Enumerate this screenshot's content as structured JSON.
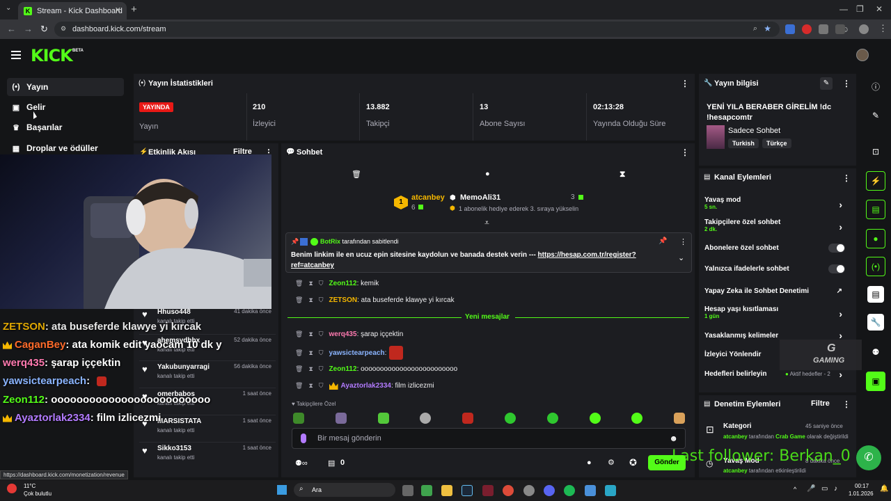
{
  "browser": {
    "tab_title": "Stream - Kick Dashboard",
    "url": "dashboard.kick.com/stream",
    "status_url": "https://dashboard.kick.com/monetization/revenue"
  },
  "header": {
    "logo": "KICK",
    "beta": "BETA"
  },
  "sidebar": {
    "items": [
      {
        "label": "Yayın",
        "icon": "broadcast-icon"
      },
      {
        "label": "Gelir",
        "icon": "revenue-icon"
      },
      {
        "label": "Başarılar",
        "icon": "trophy-icon"
      },
      {
        "label": "Droplar ve ödüller",
        "icon": "gift-icon"
      }
    ]
  },
  "stats": {
    "title": "Yayın İstatistikleri",
    "live_badge": "YAYINDA",
    "items": [
      {
        "value": "",
        "label": "Yayın"
      },
      {
        "value": "210",
        "label": "İzleyici"
      },
      {
        "value": "13.882",
        "label": "Takipçi"
      },
      {
        "value": "13",
        "label": "Abone Sayısı"
      },
      {
        "value": "02:13:28",
        "label": "Yayında Olduğu Süre"
      }
    ]
  },
  "activity": {
    "title": "Etkinlik Akışı",
    "filter": "Filtre",
    "items": [
      {
        "name": "Hhuso448",
        "sub": "kanalı takip etti",
        "time": "41 dakika önce"
      },
      {
        "name": "ahemsydhbx",
        "sub": "kanalı takip etti",
        "time": "52 dakika önce"
      },
      {
        "name": "Yakubunyarragi",
        "sub": "kanalı takip etti",
        "time": "56 dakika önce"
      },
      {
        "name": "omerbabos",
        "sub": "kanalı takip etti",
        "time": "1 saat önce"
      },
      {
        "name": "MARSISTATA",
        "sub": "kanalı takip etti",
        "time": "1 saat önce"
      },
      {
        "name": "Sikko3153",
        "sub": "kanalı takip etti",
        "time": "1 saat önce"
      }
    ]
  },
  "overlay_chat": [
    {
      "user": "ZETSON",
      "text": ": ata buseferde klawye yi kırcak",
      "color": "#f5b700",
      "crown": false
    },
    {
      "user": "CaganBey",
      "text": ": ata komik edit yaocam 10 dk y",
      "color": "#ff6b2a",
      "crown": true
    },
    {
      "user": "werq435",
      "text": ": şarap iççektin",
      "color": "#ff7ab0",
      "crown": false
    },
    {
      "user": "yawsictearpeach",
      "text": ":",
      "color": "#8ab4ff",
      "crown": false
    },
    {
      "user": "Zeon112",
      "text": ": ooooooooooooooooooooooooo",
      "color": "#53fc18",
      "crown": false
    },
    {
      "user": "Ayaztorlak2334",
      "text": ": film izlicezmi",
      "color": "#b37bff",
      "crown": true
    }
  ],
  "chat": {
    "title": "Sohbet",
    "top_gifter": {
      "rank": "1",
      "name": "atcanbey",
      "count": "6"
    },
    "gift_event": {
      "name": "MemoAli31",
      "count": "3",
      "desc": "1 abonelik hediye ederek 3. sıraya yükselin"
    },
    "pinned": {
      "by": "BotRix",
      "suffix": "tarafından sabitlendi",
      "text": "Benim linkim ile en ucuz epin sitesine kaydolun ve banada destek verin --- ",
      "link": "https://hesap.com.tr/register?ref=atcanbey"
    },
    "messages_old": [
      {
        "user": "Zeon112",
        "text": ": kemik",
        "color": "#53fc18"
      },
      {
        "user": "ZETSON",
        "text": ": ata buseferde klawye yi kırcak",
        "color": "#f5b700"
      }
    ],
    "new_messages_label": "Yeni mesajlar",
    "messages_new": [
      {
        "user": "werq435",
        "text": ": şarap iççektin",
        "color": "#ff7ab0"
      },
      {
        "user": "yawsictearpeach",
        "text": ":",
        "color": "#8ab4ff"
      },
      {
        "user": "Zeon112",
        "text": ": ooooooooooooooooooooooooo",
        "color": "#53fc18"
      },
      {
        "user": "Ayaztorlak2334",
        "text": ": film izlicezmi",
        "color": "#b37bff"
      }
    ],
    "followers_only_label": "Takipçilere Özel",
    "input_placeholder": "Bir mesaj gönderin",
    "points": "0",
    "send": "Gönder"
  },
  "stream_info": {
    "title": "Yayın bilgisi",
    "stream_title": "YENİ YILA BERABER GİRELİM !dc !hesapcomtr",
    "category": "Sadece Sohbet",
    "tags": [
      "Turkish",
      "Türkçe"
    ]
  },
  "channel_actions": {
    "title": "Kanal Eylemleri",
    "rows": [
      {
        "label": "Yavaş mod",
        "sub": "5 sn.",
        "kind": "chevron"
      },
      {
        "label": "Takipçilere özel sohbet",
        "sub": "2 dk.",
        "kind": "chevron"
      },
      {
        "label": "Abonelere özel sohbet",
        "sub": "",
        "kind": "toggle"
      },
      {
        "label": "Yalnızca ifadelerle sohbet",
        "sub": "",
        "kind": "toggle"
      },
      {
        "label": "Yapay Zeka ile Sohbet Denetimi",
        "sub": "",
        "kind": "external"
      },
      {
        "label": "Hesap yaşı kısıtlaması",
        "sub": "1 gün",
        "kind": "chevron"
      },
      {
        "label": "Yasaklanmış kelimeler",
        "sub": "",
        "kind": "chevron"
      },
      {
        "label": "İzleyici Yönlendir",
        "sub": "",
        "kind": "none"
      },
      {
        "label": "Hedefleri belirleyin",
        "sub": "",
        "kind": "goal"
      }
    ],
    "goal_status": "Aktif hedefler - 2"
  },
  "mod_actions": {
    "title": "Denetim Eylemleri",
    "filter": "Filtre",
    "items": [
      {
        "title": "Kategori",
        "time": "45 saniye önce",
        "actor": "atcanbey",
        "mid": " tarafından ",
        "target": "Crab Game",
        "rest": " olarak değiştirildi"
      },
      {
        "title": "Yavaş Mod",
        "time": "8 dakika önce",
        "actor": "atcanbey",
        "mid": " tarafından etkinleştirildi",
        "target": "",
        "rest": ""
      }
    ]
  },
  "overlay": {
    "last_follower": "Last follower: Berkan_0",
    "gaming_logo": "GAMING"
  },
  "taskbar": {
    "weather_temp": "11°C",
    "weather_desc": "Çok bulutlu",
    "search": "Ara",
    "time": "00:17",
    "date": "1.01.2026"
  },
  "colors": {
    "accent": "#53fc18",
    "live": "#e91916",
    "bg": "#141517",
    "panel": "#1c1d21"
  }
}
